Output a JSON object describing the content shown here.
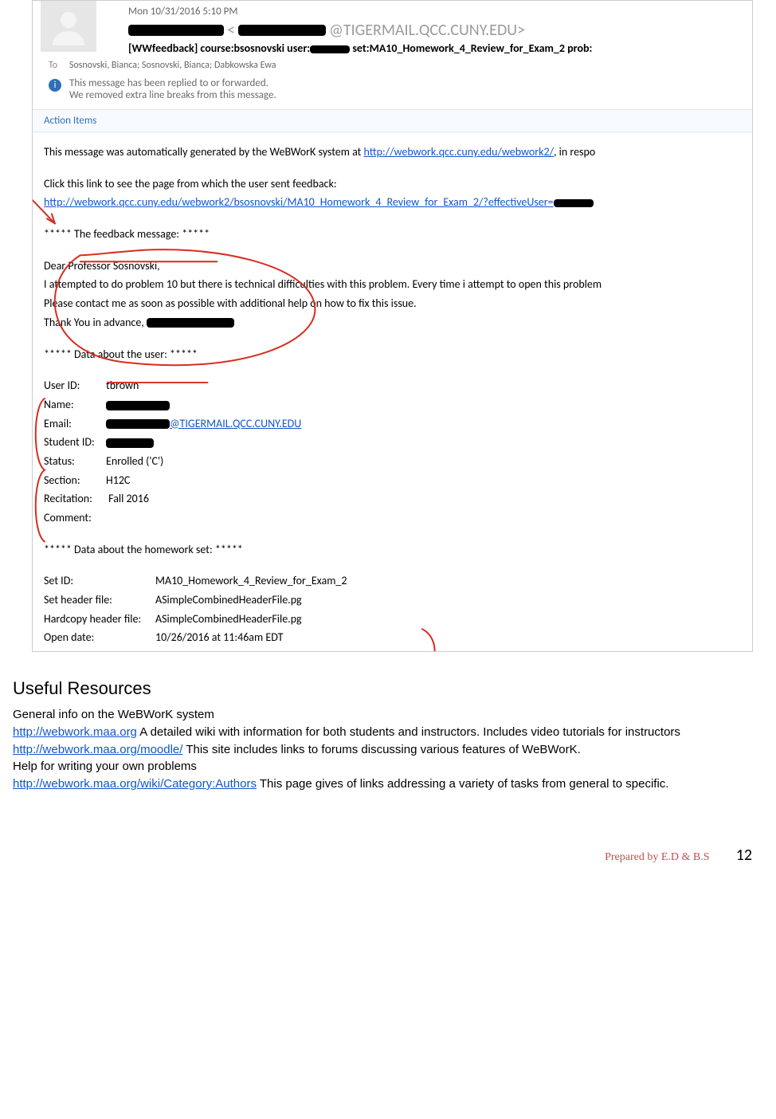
{
  "email": {
    "date": "Mon 10/31/2016 5:10 PM",
    "from_domain": "@TIGERMAIL.QCC.CUNY.EDU>",
    "from_angle": "<",
    "subject_prefix": "[WWfeedback] course:bsosnovski user:",
    "subject_suffix": " set:MA10_Homework_4_Review_for_Exam_2 prob:",
    "to_label": "To",
    "to_value": "Sosnovski, Bianca; Sosnovski, Bianca; Dabkowska Ewa",
    "info_line1": "This message has been replied to or forwarded.",
    "info_line2": "We removed extra line breaks from this message.",
    "action_items": "Action Items",
    "body": {
      "auto1a": "This  message was automatically generated by the WeBWorK system at ",
      "auto1_link": "http://webwork.qcc.cuny.edu/webwork2/",
      "auto1b": ", in respo",
      "clickline": "Click this link to see the page from which the user sent feedback:",
      "feedback_link": "http://webwork.qcc.cuny.edu/webwork2/bsosnovski/MA10_Homework_4_Review_for_Exam_2/?effectiveUser=",
      "hdr_feedback": "***** The feedback message: *****",
      "greet": "Dear Professor Sosnovski,",
      "msg1": "I attempted to do problem 10 but there is technical difficulties with this problem. Every time i attempt to open this problem",
      "msg2": "Please contact me as soon as possible with additional help on how to fix this issue.",
      "msg3": "Thank You in advance,",
      "hdr_user": "***** Data about the user: *****",
      "u_id_lbl": "User ID:",
      "u_id_val": "tbrown",
      "u_name_lbl": "Name:",
      "u_email_lbl": "Email:",
      "u_email_val": "@TIGERMAIL.QCC.CUNY.EDU",
      "u_sid_lbl": "Student ID:",
      "u_status_lbl": "Status:",
      "u_status_val": "Enrolled ('C')",
      "u_section_lbl": "Section:",
      "u_section_val": "H12C",
      "u_rec_lbl": "Recitation:",
      "u_rec_val": "Fall 2016",
      "u_comment_lbl": "Comment:",
      "hdr_set": "***** Data about the homework set: *****",
      "s_id_lbl": "Set ID:",
      "s_id_val": "MA10_Homework_4_Review_for_Exam_2",
      "s_hdr_lbl": "Set header file:",
      "s_hdr_val": "ASimpleCombinedHeaderFile.pg",
      "s_hc_lbl": "Hardcopy header file:",
      "s_hc_val": "ASimpleCombinedHeaderFile.pg",
      "s_open_lbl": "Open date:",
      "s_open_val": "10/26/2016 at 11:46am EDT"
    }
  },
  "resources": {
    "title": "Useful Resources",
    "l1": "General info on the WeBWorK system",
    "link1": "http://webwork.maa.org",
    "l1b": " A detailed wiki with information for both students and instructors. Includes video tutorials for instructors",
    "link2": "http://webwork.maa.org/moodle/",
    "l2b": " This site includes links to forums discussing various features of WeBWorK.",
    "l3": "Help for writing your own problems",
    "link3": "http://webwork.maa.org/wiki/Category:Authors",
    "l3b": " This page gives of links addressing a variety of tasks from general to specific."
  },
  "footer": {
    "prepared": "Prepared by E.D & B.S",
    "page": "12"
  }
}
